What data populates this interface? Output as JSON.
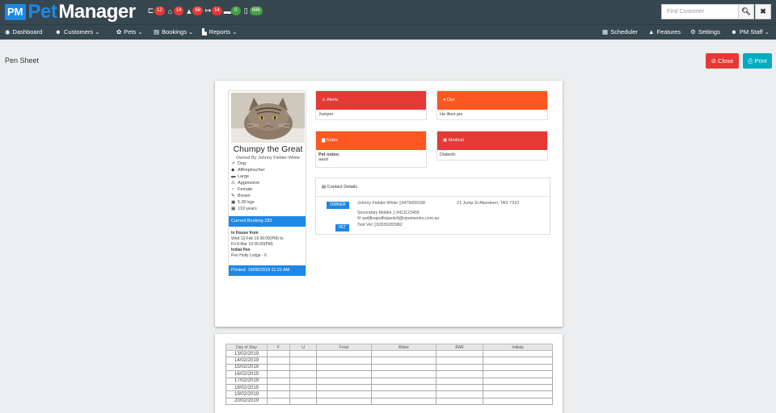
{
  "brand": {
    "pm": "PM",
    "pet": "Pet",
    "manager": "Manager"
  },
  "badges": [
    {
      "icon": "bed-icon",
      "glyph": "⊏",
      "count": "12",
      "color": "#e53935"
    },
    {
      "icon": "home-icon",
      "glyph": "⌂",
      "count": "14",
      "color": "#e53935"
    },
    {
      "icon": "bell-icon",
      "glyph": "▲",
      "count": "68",
      "color": "#e53935"
    },
    {
      "icon": "sign-out-icon",
      "glyph": "↦",
      "count": "14",
      "color": "#e53935"
    },
    {
      "icon": "truck-icon",
      "glyph": "▬",
      "count": "0",
      "color": "#43a047"
    },
    {
      "icon": "mobile-icon",
      "glyph": "▯",
      "count": "686",
      "color": "#43a047"
    }
  ],
  "search": {
    "placeholder": "Find Customer",
    "search_glyph": "🔍︎",
    "clear_glyph": "✖"
  },
  "nav": {
    "dashboard": "Dashboard",
    "customers": "Customers",
    "pets": "Pets",
    "bookings": "Bookings",
    "reports": "Reports",
    "scheduler": "Scheduler",
    "features": "Features",
    "settings": "Settings",
    "staff": "PM Staff"
  },
  "page": {
    "title": "Pen Sheet",
    "close": "Close",
    "print": "Print"
  },
  "pet": {
    "name": "Chumpy the Great",
    "owner": "Owned By Johnny Fielder-White",
    "attributes": [
      {
        "icon": "dog-icon",
        "glyph": "↗",
        "text": "Dog"
      },
      {
        "icon": "tag-icon",
        "glyph": "◆",
        "text": "Affenpinscher"
      },
      {
        "icon": "size-icon",
        "glyph": "▬",
        "text": "Large"
      },
      {
        "icon": "warning-icon",
        "glyph": "⚠",
        "text": "Aggressive"
      },
      {
        "icon": "venus-icon",
        "glyph": "♀",
        "text": "Female"
      },
      {
        "icon": "paint-icon",
        "glyph": "✎",
        "text": "Brown"
      },
      {
        "icon": "weight-icon",
        "glyph": "▣",
        "text": "5.00 kgs"
      },
      {
        "icon": "calendar-icon",
        "glyph": "▦",
        "text": "119 years"
      }
    ],
    "current_booking": "Current Booking 283",
    "in_house_label": "In House from",
    "in_house_from": "Wed 13 Feb 19 06:00(PM) to",
    "in_house_to": "Fri 8 Mar 19 06:00(PM)",
    "initial_pen_label": "Initial Pen",
    "initial_pen": "Pen Holly Lodge - 6",
    "printed": "Printed: 19/08/2019 11:22 AM"
  },
  "panels": {
    "alerts": {
      "title": "Alerts",
      "body": "Jumper"
    },
    "diet": {
      "title": "Diet",
      "body": "He likes pie"
    },
    "notes": {
      "title": "Notes",
      "label": "Pet notes:",
      "body": "aasd"
    },
    "medical": {
      "title": "Medical",
      "body": "Diabetic"
    }
  },
  "contact": {
    "title": "Contact Details",
    "owner_tag": "OWNER",
    "owner_name": "Johnny Fielder-White",
    "owner_phone": "0479009188",
    "owner_address": "21 Jump St Aberdeen, TAS 7310",
    "secondary_mobile_label": "Secondary Mobile",
    "secondary_mobile": "0411123456",
    "email": "asdjfioajsdfoijasdofj@ojnetworks.com.au",
    "vet_tag": "VET",
    "vet_name": "Test Vet",
    "vet_phone": "92839283982"
  },
  "pen_table": {
    "headers": [
      "Day of Stay",
      "F",
      "U",
      "Food",
      "Water",
      "BAR",
      "Initials"
    ],
    "rows": [
      "13/02/2019",
      "14/02/2019",
      "15/02/2019",
      "16/02/2019",
      "17/02/2019",
      "18/02/2019",
      "19/02/2019",
      "20/02/2019"
    ]
  }
}
